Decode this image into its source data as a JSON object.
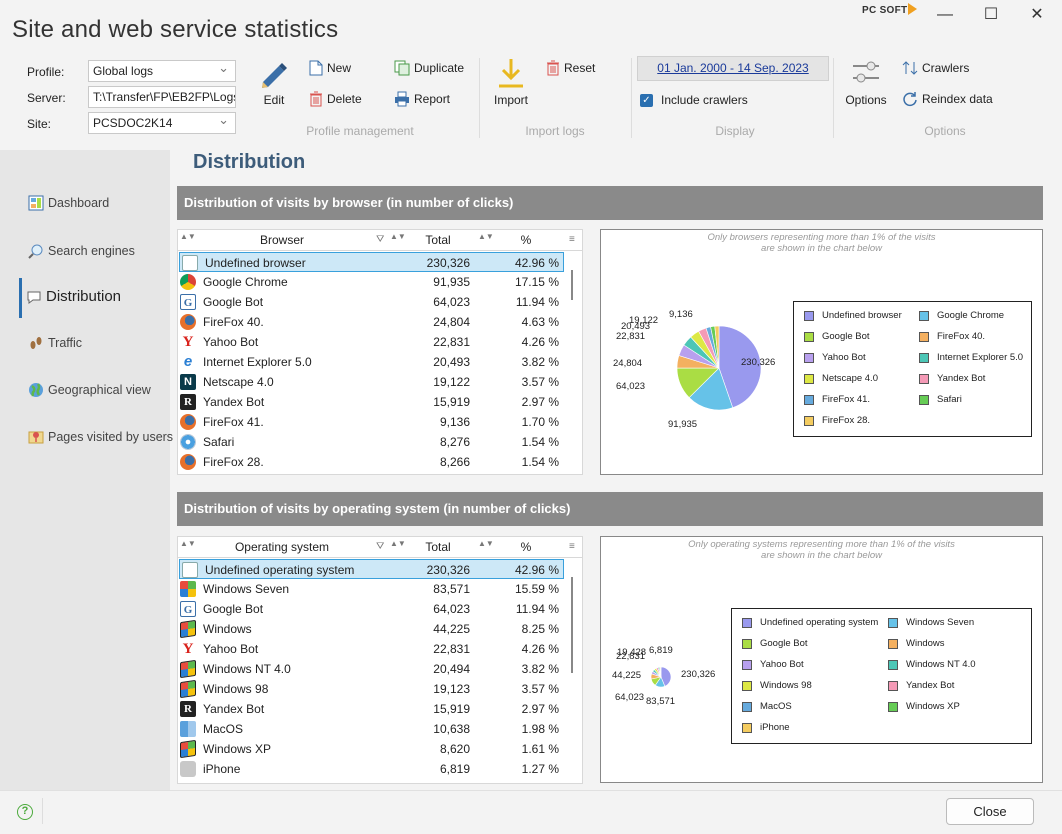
{
  "window": {
    "title": "Site and web service statistics",
    "brand": "PC SOFT",
    "minimize_glyph": "—",
    "maximize_glyph": "☐",
    "close_glyph": "✕"
  },
  "ribbon": {
    "profile_label": "Profile:",
    "profile_value": "Global logs",
    "server_label": "Server:",
    "server_value": "T:\\Transfer\\FP\\EB2FP\\Logs",
    "site_label": "Site:",
    "site_value": "PCSDOC2K14",
    "edit_label": "Edit",
    "new_label": "New",
    "delete_label": "Delete",
    "duplicate_label": "Duplicate",
    "report_label": "Report",
    "profile_management_caption": "Profile management",
    "import_label": "Import",
    "reset_label": "Reset",
    "import_logs_caption": "Import logs",
    "date_range": "01 Jan. 2000 - 14 Sep. 2023",
    "include_crawlers_label": "Include crawlers",
    "include_crawlers_checked": true,
    "display_caption": "Display",
    "options_label": "Options",
    "crawlers_label": "Crawlers",
    "reindex_label": "Reindex data",
    "options_caption": "Options"
  },
  "sidebar": {
    "items": [
      {
        "label": "Dashboard",
        "icon": "dashboard-icon"
      },
      {
        "label": "Search engines",
        "icon": "search-icon"
      },
      {
        "label": "Distribution",
        "icon": "speech-bubble-icon"
      },
      {
        "label": "Traffic",
        "icon": "footsteps-icon"
      },
      {
        "label": "Geographical view",
        "icon": "globe-icon"
      },
      {
        "label": "Pages visited by users",
        "icon": "map-pin-icon"
      }
    ],
    "active": "Distribution"
  },
  "main": {
    "title": "Distribution",
    "browser_section": {
      "header": "Distribution of visits by browser (in number of clicks)",
      "col_name": "Browser",
      "col_total": "Total",
      "col_pct": "%",
      "rows": [
        {
          "name": "Undefined browser",
          "total": "230,326",
          "pct": "42.96 %",
          "icon": "blank",
          "selected": true
        },
        {
          "name": "Google Chrome",
          "total": "91,935",
          "pct": "17.15 %",
          "icon": "chrome"
        },
        {
          "name": "Google Bot",
          "total": "64,023",
          "pct": "11.94 %",
          "icon": "google"
        },
        {
          "name": "FireFox 40.",
          "total": "24,804",
          "pct": "4.63 %",
          "icon": "firefox"
        },
        {
          "name": "Yahoo Bot",
          "total": "22,831",
          "pct": "4.26 %",
          "icon": "yahoo"
        },
        {
          "name": "Internet Explorer 5.0",
          "total": "20,493",
          "pct": "3.82 %",
          "icon": "ie"
        },
        {
          "name": "Netscape 4.0",
          "total": "19,122",
          "pct": "3.57 %",
          "icon": "netscape"
        },
        {
          "name": "Yandex Bot",
          "total": "15,919",
          "pct": "2.97 %",
          "icon": "yandex"
        },
        {
          "name": "FireFox 41.",
          "total": "9,136",
          "pct": "1.70 %",
          "icon": "firefox"
        },
        {
          "name": "Safari",
          "total": "8,276",
          "pct": "1.54 %",
          "icon": "safari"
        },
        {
          "name": "FireFox 28.",
          "total": "8,266",
          "pct": "1.54 %",
          "icon": "firefox"
        }
      ],
      "chart_note": "Only browsers representing more than 1% of the visits\nare shown in the chart below"
    },
    "os_section": {
      "header": "Distribution of visits by operating system (in number of clicks)",
      "col_name": "Operating system",
      "col_total": "Total",
      "col_pct": "%",
      "rows": [
        {
          "name": "Undefined operating system",
          "total": "230,326",
          "pct": "42.96 %",
          "icon": "blank",
          "selected": true
        },
        {
          "name": "Windows Seven",
          "total": "83,571",
          "pct": "15.59 %",
          "icon": "windows-color"
        },
        {
          "name": "Google Bot",
          "total": "64,023",
          "pct": "11.94 %",
          "icon": "google"
        },
        {
          "name": "Windows",
          "total": "44,225",
          "pct": "8.25 %",
          "icon": "windows-flag"
        },
        {
          "name": "Yahoo Bot",
          "total": "22,831",
          "pct": "4.26 %",
          "icon": "yahoo"
        },
        {
          "name": "Windows NT 4.0",
          "total": "20,494",
          "pct": "3.82 %",
          "icon": "windows-flag"
        },
        {
          "name": "Windows 98",
          "total": "19,123",
          "pct": "3.57 %",
          "icon": "windows-flag"
        },
        {
          "name": "Yandex Bot",
          "total": "15,919",
          "pct": "2.97 %",
          "icon": "yandex"
        },
        {
          "name": "MacOS",
          "total": "10,638",
          "pct": "1.98 %",
          "icon": "finder"
        },
        {
          "name": "Windows XP",
          "total": "8,620",
          "pct": "1.61 %",
          "icon": "windows-flag"
        },
        {
          "name": "iPhone",
          "total": "6,819",
          "pct": "1.27 %",
          "icon": "apple"
        }
      ],
      "chart_note": "Only operating systems representing more than 1% of the visits\nare shown in the chart below"
    }
  },
  "footer": {
    "close_label": "Close",
    "help_glyph": "?"
  },
  "chart_data": [
    {
      "type": "pie",
      "title": "",
      "legend_position": "right",
      "categories": [
        "Undefined browser",
        "Google Chrome",
        "Google Bot",
        "FireFox 40.",
        "Yahoo Bot",
        "Internet Explorer 5.0",
        "Netscape 4.0",
        "Yandex Bot",
        "FireFox 41.",
        "Safari",
        "FireFox 28."
      ],
      "values": [
        230326,
        91935,
        64023,
        24804,
        22831,
        20493,
        19122,
        15919,
        9136,
        8276,
        8266
      ],
      "slice_labels": [
        "230,326",
        "91,935",
        "64,023",
        "24,804",
        "22,831",
        "20,493",
        "19,122",
        "",
        "9,136",
        "",
        ""
      ],
      "colors": [
        "#9999ee",
        "#66c2e8",
        "#aadd44",
        "#f4b060",
        "#b8a0ee",
        "#4cc6b6",
        "#dde844",
        "#f49ab6",
        "#66aadd",
        "#66cc55",
        "#f4cc60"
      ]
    },
    {
      "type": "pie",
      "title": "",
      "legend_position": "right",
      "categories": [
        "Undefined operating system",
        "Windows Seven",
        "Google Bot",
        "Windows",
        "Yahoo Bot",
        "Windows NT 4.0",
        "Windows 98",
        "Yandex Bot",
        "MacOS",
        "Windows XP",
        "iPhone"
      ],
      "values": [
        230326,
        83571,
        64023,
        44225,
        22831,
        20494,
        19123,
        15919,
        10638,
        8620,
        6819
      ],
      "slice_labels": [
        "230,326",
        "83,571",
        "64,023",
        "44,225",
        "22,831",
        "",
        "19,428",
        "",
        "",
        "",
        "6,819"
      ],
      "colors": [
        "#9999ee",
        "#66c2e8",
        "#aadd44",
        "#f4b060",
        "#b8a0ee",
        "#4cc6b6",
        "#dde844",
        "#f49ab6",
        "#66aadd",
        "#66cc55",
        "#f4cc60"
      ]
    }
  ]
}
